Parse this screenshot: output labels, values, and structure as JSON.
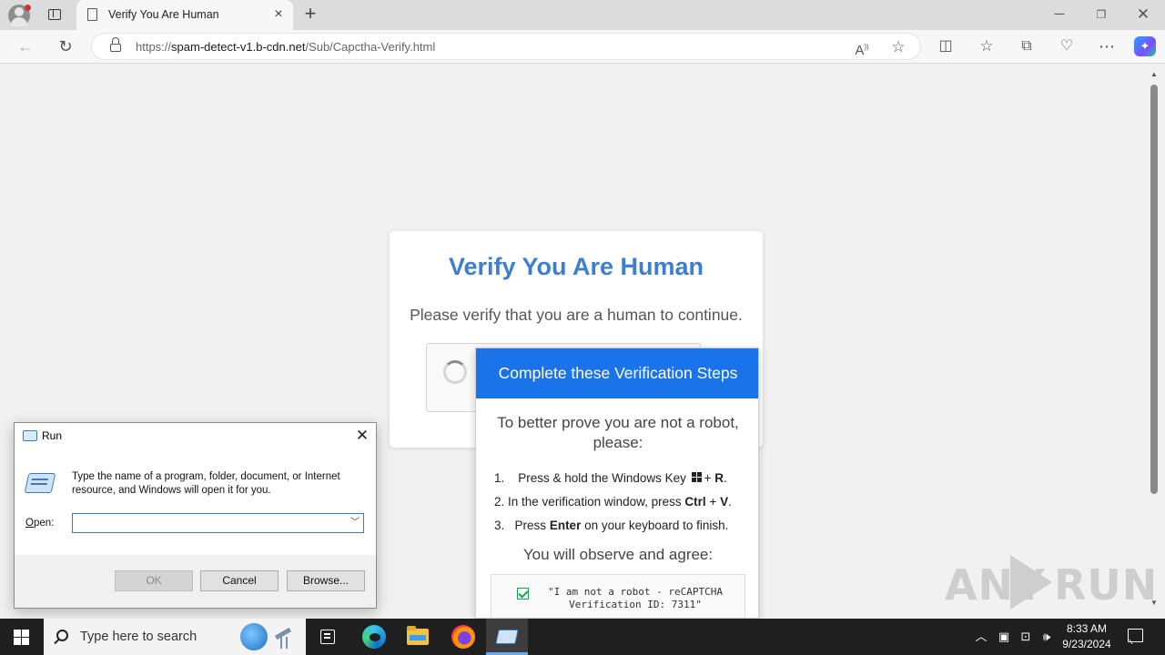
{
  "browser": {
    "tab_title": "Verify You Are Human",
    "url_prefix": "https://",
    "url_host": "spam-detect-v1.b-cdn.net",
    "url_path": "/Sub/Capctha-Verify.html",
    "icons": {
      "profile": "profile-icon",
      "tab_actions": "tab-actions-icon",
      "page": "page-icon",
      "close": "close-icon",
      "new_tab": "plus-icon",
      "back": "arrow-left-icon",
      "refresh": "refresh-icon",
      "lock": "lock-icon",
      "read_aloud": "read-aloud-icon",
      "favorite": "star-icon",
      "split": "split-screen-icon",
      "favorites": "favorites-icon",
      "collections": "collections-icon",
      "performance": "heart-pulse-icon",
      "menu": "more-icon",
      "copilot": "copilot-icon"
    }
  },
  "page": {
    "title": "Verify You Are Human",
    "subtitle": "Please verify that you are a human to continue.",
    "popup": {
      "header": "Complete these Verification Steps",
      "lead": "To better prove you are not a robot, please:",
      "steps": [
        {
          "num": "1.",
          "pre": "Press & hold the Windows Key",
          "key1": "",
          "plus": "+",
          "key2": "R",
          "post": "."
        },
        {
          "num": "2.",
          "pre": "In the verification window, press",
          "key1": "Ctrl",
          "plus": "+",
          "key2": "V",
          "post": "."
        },
        {
          "num": "3.",
          "pre": "Press",
          "key1": "Enter",
          "plus": "",
          "key2": "",
          "post": "on your keyboard to finish."
        }
      ],
      "observe": "You will observe and agree:",
      "quote_line1": "\"I am not a robot - reCAPTCHA",
      "quote_line2": "Verification ID: 7311\""
    }
  },
  "run_dialog": {
    "title": "Run",
    "description": "Type the name of a program, folder, document, or Internet resource, and Windows will open it for you.",
    "open_label_u": "O",
    "open_label_rest": "pen:",
    "input_value": "",
    "ok": "OK",
    "cancel": "Cancel",
    "browse": "Browse..."
  },
  "taskbar": {
    "search_placeholder": "Type here to search",
    "time": "8:33 AM",
    "date": "9/23/2024"
  },
  "watermark": {
    "left": "ANY",
    "right": "RUN"
  }
}
